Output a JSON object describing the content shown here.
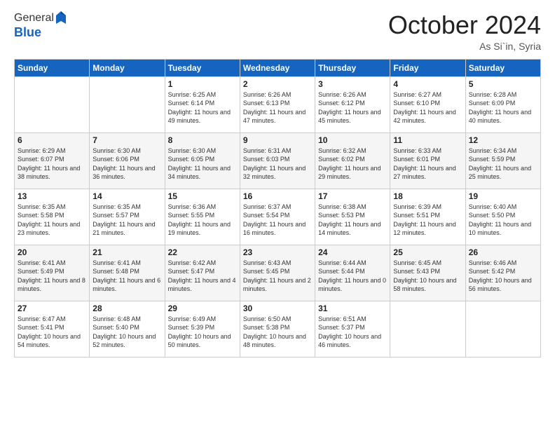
{
  "header": {
    "logo": {
      "line1": "General",
      "line2": "Blue"
    },
    "title": "October 2024",
    "location": "As Si`in, Syria"
  },
  "weekdays": [
    "Sunday",
    "Monday",
    "Tuesday",
    "Wednesday",
    "Thursday",
    "Friday",
    "Saturday"
  ],
  "weeks": [
    [
      null,
      null,
      {
        "day": 1,
        "sunrise": "6:25 AM",
        "sunset": "6:14 PM",
        "daylight": "11 hours and 49 minutes."
      },
      {
        "day": 2,
        "sunrise": "6:26 AM",
        "sunset": "6:13 PM",
        "daylight": "11 hours and 47 minutes."
      },
      {
        "day": 3,
        "sunrise": "6:26 AM",
        "sunset": "6:12 PM",
        "daylight": "11 hours and 45 minutes."
      },
      {
        "day": 4,
        "sunrise": "6:27 AM",
        "sunset": "6:10 PM",
        "daylight": "11 hours and 42 minutes."
      },
      {
        "day": 5,
        "sunrise": "6:28 AM",
        "sunset": "6:09 PM",
        "daylight": "11 hours and 40 minutes."
      }
    ],
    [
      {
        "day": 6,
        "sunrise": "6:29 AM",
        "sunset": "6:07 PM",
        "daylight": "11 hours and 38 minutes."
      },
      {
        "day": 7,
        "sunrise": "6:30 AM",
        "sunset": "6:06 PM",
        "daylight": "11 hours and 36 minutes."
      },
      {
        "day": 8,
        "sunrise": "6:30 AM",
        "sunset": "6:05 PM",
        "daylight": "11 hours and 34 minutes."
      },
      {
        "day": 9,
        "sunrise": "6:31 AM",
        "sunset": "6:03 PM",
        "daylight": "11 hours and 32 minutes."
      },
      {
        "day": 10,
        "sunrise": "6:32 AM",
        "sunset": "6:02 PM",
        "daylight": "11 hours and 29 minutes."
      },
      {
        "day": 11,
        "sunrise": "6:33 AM",
        "sunset": "6:01 PM",
        "daylight": "11 hours and 27 minutes."
      },
      {
        "day": 12,
        "sunrise": "6:34 AM",
        "sunset": "5:59 PM",
        "daylight": "11 hours and 25 minutes."
      }
    ],
    [
      {
        "day": 13,
        "sunrise": "6:35 AM",
        "sunset": "5:58 PM",
        "daylight": "11 hours and 23 minutes."
      },
      {
        "day": 14,
        "sunrise": "6:35 AM",
        "sunset": "5:57 PM",
        "daylight": "11 hours and 21 minutes."
      },
      {
        "day": 15,
        "sunrise": "6:36 AM",
        "sunset": "5:55 PM",
        "daylight": "11 hours and 19 minutes."
      },
      {
        "day": 16,
        "sunrise": "6:37 AM",
        "sunset": "5:54 PM",
        "daylight": "11 hours and 16 minutes."
      },
      {
        "day": 17,
        "sunrise": "6:38 AM",
        "sunset": "5:53 PM",
        "daylight": "11 hours and 14 minutes."
      },
      {
        "day": 18,
        "sunrise": "6:39 AM",
        "sunset": "5:51 PM",
        "daylight": "11 hours and 12 minutes."
      },
      {
        "day": 19,
        "sunrise": "6:40 AM",
        "sunset": "5:50 PM",
        "daylight": "11 hours and 10 minutes."
      }
    ],
    [
      {
        "day": 20,
        "sunrise": "6:41 AM",
        "sunset": "5:49 PM",
        "daylight": "11 hours and 8 minutes."
      },
      {
        "day": 21,
        "sunrise": "6:41 AM",
        "sunset": "5:48 PM",
        "daylight": "11 hours and 6 minutes."
      },
      {
        "day": 22,
        "sunrise": "6:42 AM",
        "sunset": "5:47 PM",
        "daylight": "11 hours and 4 minutes."
      },
      {
        "day": 23,
        "sunrise": "6:43 AM",
        "sunset": "5:45 PM",
        "daylight": "11 hours and 2 minutes."
      },
      {
        "day": 24,
        "sunrise": "6:44 AM",
        "sunset": "5:44 PM",
        "daylight": "11 hours and 0 minutes."
      },
      {
        "day": 25,
        "sunrise": "6:45 AM",
        "sunset": "5:43 PM",
        "daylight": "10 hours and 58 minutes."
      },
      {
        "day": 26,
        "sunrise": "6:46 AM",
        "sunset": "5:42 PM",
        "daylight": "10 hours and 56 minutes."
      }
    ],
    [
      {
        "day": 27,
        "sunrise": "6:47 AM",
        "sunset": "5:41 PM",
        "daylight": "10 hours and 54 minutes."
      },
      {
        "day": 28,
        "sunrise": "6:48 AM",
        "sunset": "5:40 PM",
        "daylight": "10 hours and 52 minutes."
      },
      {
        "day": 29,
        "sunrise": "6:49 AM",
        "sunset": "5:39 PM",
        "daylight": "10 hours and 50 minutes."
      },
      {
        "day": 30,
        "sunrise": "6:50 AM",
        "sunset": "5:38 PM",
        "daylight": "10 hours and 48 minutes."
      },
      {
        "day": 31,
        "sunrise": "6:51 AM",
        "sunset": "5:37 PM",
        "daylight": "10 hours and 46 minutes."
      },
      null,
      null
    ]
  ]
}
